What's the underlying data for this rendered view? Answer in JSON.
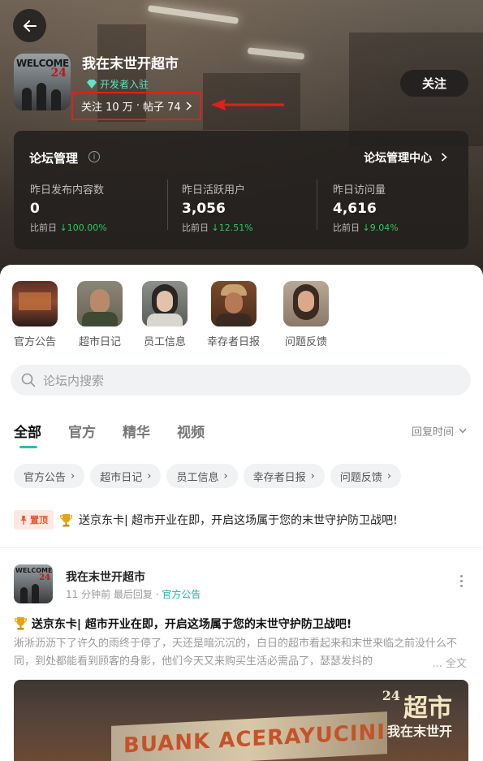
{
  "header": {
    "forum_name": "我在末世开超市",
    "icon_text": "WELCOME",
    "icon_number": "24",
    "dev_badge": "开发者入驻",
    "followers": "关注 10 万",
    "separator": "·",
    "posts": "帖子 74",
    "follow_button": "关注"
  },
  "management": {
    "title": "论坛管理",
    "center_link": "论坛管理中心",
    "stats": [
      {
        "label": "昨日发布内容数",
        "value": "0",
        "compare_label": "比前日",
        "change": "100.00%"
      },
      {
        "label": "昨日活跃用户",
        "value": "3,056",
        "compare_label": "比前日",
        "change": "12.51%"
      },
      {
        "label": "昨日访问量",
        "value": "4,616",
        "compare_label": "比前日",
        "change": "9.04%"
      }
    ]
  },
  "categories": [
    {
      "label": "官方公告"
    },
    {
      "label": "超市日记"
    },
    {
      "label": "员工信息"
    },
    {
      "label": "幸存者日报"
    },
    {
      "label": "问题反馈"
    }
  ],
  "search": {
    "placeholder": "论坛内搜索"
  },
  "tabs": [
    "全部",
    "官方",
    "精华",
    "视频"
  ],
  "sort": {
    "label": "回复时间"
  },
  "chips": [
    "官方公告",
    "超市日记",
    "员工信息",
    "幸存者日报",
    "问题反馈"
  ],
  "pinned": {
    "badge": "置顶",
    "text": "送京东卡| 超市开业在即，开启这场属于您的末世守护防卫战吧!"
  },
  "post": {
    "author": "我在末世开超市",
    "time": "11 分钟前 最后回复",
    "dot": "·",
    "tag": "官方公告",
    "title": "送京东卡| 超市开业在即，开启这场属于您的末世守护防卫战吧!",
    "body": "淅淅沥沥下了许久的雨终于停了，天还是暗沉沉的，白日的超市看起来和末世来临之前没什么不同，到处都能看到顾客的身影，他们今天又来购买生活必需品了，瑟瑟发抖的",
    "more": "... 全文",
    "banner_sign": "BUANK ACERAYUCINI",
    "banner_logo": "超市",
    "banner_logo_num": "24",
    "banner_logo_sub": "我在末世开"
  }
}
